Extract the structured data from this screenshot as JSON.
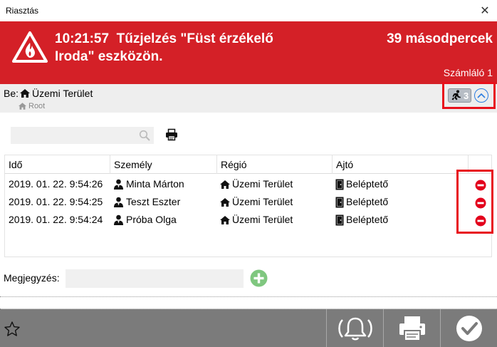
{
  "window": {
    "title": "Riasztás",
    "close_glyph": "✕"
  },
  "banner": {
    "time": "10:21:57",
    "message": "Tűzjelzés \"Füst érzékelő Iroda\" eszközön.",
    "seconds": "39 másodpercek",
    "counter": "Számláló 1",
    "icon": "fire-warning-icon",
    "color": "#d42027"
  },
  "location": {
    "prefix": "Be:",
    "area": "Üzemi Terület",
    "root": "Root",
    "occupancy_count": "3"
  },
  "toolbar": {
    "search_value": "",
    "search_placeholder": ""
  },
  "table": {
    "columns": [
      "Idő",
      "Személy",
      "Régió",
      "Ajtó"
    ],
    "rows": [
      {
        "time": "2019. 01. 22. 9:54:26",
        "person": "Minta Márton",
        "region": "Üzemi Terület",
        "door": "Beléptető"
      },
      {
        "time": "2019. 01. 22. 9:54:25",
        "person": "Teszt Eszter",
        "region": "Üzemi Terület",
        "door": "Beléptető"
      },
      {
        "time": "2019. 01. 22. 9:54:24",
        "person": "Próba Olga",
        "region": "Üzemi Terület",
        "door": "Beléptető"
      }
    ]
  },
  "note": {
    "label": "Megjegyzés:",
    "value": ""
  },
  "footer": {
    "buttons": [
      "favorite-star-icon",
      "alarm-bell-icon",
      "printer-icon",
      "confirm-check-icon"
    ]
  },
  "colors": {
    "highlight": "#e8101b",
    "remove": "#e3001b",
    "add": "#7fc77f",
    "footer": "#7b7b7b"
  }
}
